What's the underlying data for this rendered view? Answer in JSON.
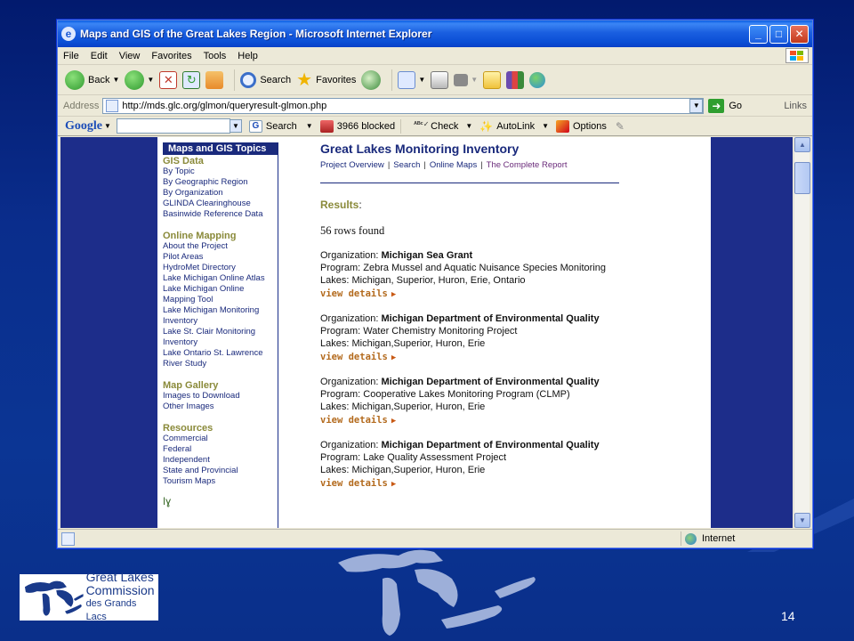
{
  "browser": {
    "title": "Maps and GIS of the Great Lakes Region - Microsoft Internet Explorer",
    "menu": [
      "File",
      "Edit",
      "View",
      "Favorites",
      "Tools",
      "Help"
    ],
    "toolbar": {
      "back": "Back",
      "search": "Search",
      "favorites": "Favorites"
    },
    "address": {
      "label": "Address",
      "url": "http://mds.glc.org/glmon/queryresult-glmon.php",
      "go": "Go",
      "links": "Links"
    },
    "google": {
      "logo_a": "Goo",
      "logo_b": "gle",
      "search": "Search",
      "blocked": "3966 blocked",
      "check": "Check",
      "autolink": "AutoLink",
      "options": "Options"
    },
    "status": {
      "zone": "Internet"
    }
  },
  "sidebar": {
    "heading": "Maps and GIS Topics",
    "sections": [
      {
        "title": "GIS Data",
        "links": [
          "By Topic",
          "By Geographic Region",
          "By Organization",
          "GLINDA Clearinghouse",
          "Basinwide Reference Data"
        ]
      },
      {
        "title": "Online Mapping",
        "links": [
          "About the Project",
          "Pilot Areas",
          "HydroMet Directory",
          "Lake Michigan Online Atlas",
          "Lake Michigan Online",
          "Mapping Tool",
          "Lake Michigan Monitoring",
          "Inventory",
          "Lake St. Clair Monitoring",
          "Inventory",
          "Lake Ontario St. Lawrence",
          "River Study"
        ]
      },
      {
        "title": "Map Gallery",
        "links": [
          "Images to Download",
          "Other Images"
        ]
      },
      {
        "title": "Resources",
        "links": [
          "Commercial",
          "Federal",
          "Independent",
          "State and Provincial",
          "Tourism Maps"
        ]
      }
    ]
  },
  "content": {
    "title": "Great Lakes Monitoring Inventory",
    "nav": [
      "Project Overview",
      "Search",
      "Online Maps",
      "The Complete Report"
    ],
    "results_label": "Results",
    "results_colon": ":",
    "rows_found": "56 rows found",
    "labels": {
      "organization": "Organization: ",
      "program": "Program: ",
      "lakes": "Lakes: ",
      "view_details": "view details"
    },
    "records": [
      {
        "organization": "Michigan Sea Grant",
        "program": "Zebra Mussel and Aquatic Nuisance Species Monitoring",
        "lakes": "Michigan, Superior, Huron, Erie, Ontario"
      },
      {
        "organization": "Michigan Department of Environmental Quality",
        "program": "Water Chemistry Monitoring Project",
        "lakes": "Michigan,Superior, Huron, Erie"
      },
      {
        "organization": "Michigan Department of Environmental Quality",
        "program": "Cooperative Lakes Monitoring Program (CLMP)",
        "lakes": "Michigan,Superior, Huron, Erie"
      },
      {
        "organization": "Michigan Department of Environmental Quality",
        "program": "Lake Quality Assessment Project",
        "lakes": "Michigan,Superior, Huron, Erie"
      }
    ]
  },
  "slide": {
    "logo": {
      "line1": "Great Lakes",
      "line2": "Commission",
      "line3": "des Grands Lacs"
    },
    "page_number": "14"
  },
  "colors": {
    "slide_background": "#0b3594",
    "title_bar": "#0b4fd6",
    "sidebar_heading": "#1a2a7c",
    "section_title": "#8a8a3a",
    "view_details": "#b36a1d"
  }
}
